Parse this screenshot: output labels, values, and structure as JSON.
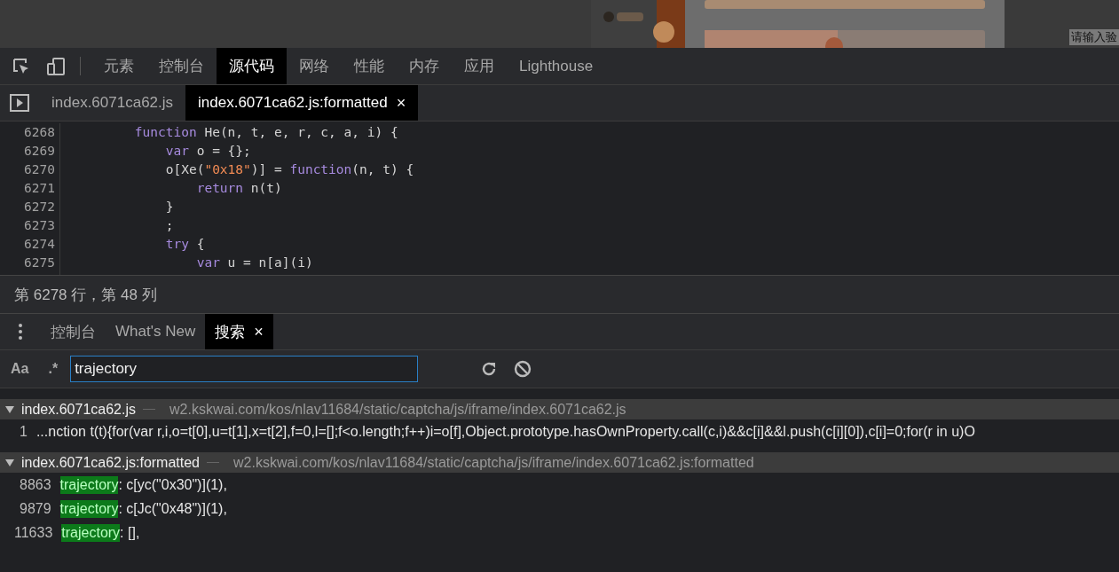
{
  "page_behind": {
    "prompt_text": "请输入验"
  },
  "main_tabs": [
    {
      "label": "元素",
      "selected": false
    },
    {
      "label": "控制台",
      "selected": false
    },
    {
      "label": "源代码",
      "selected": true
    },
    {
      "label": "网络",
      "selected": false
    },
    {
      "label": "性能",
      "selected": false
    },
    {
      "label": "内存",
      "selected": false
    },
    {
      "label": "应用",
      "selected": false
    },
    {
      "label": "Lighthouse",
      "selected": false
    }
  ],
  "file_tabs": [
    {
      "label": "index.6071ca62.js",
      "selected": false,
      "closable": false
    },
    {
      "label": "index.6071ca62.js:formatted",
      "selected": true,
      "closable": true,
      "close": "×"
    }
  ],
  "code": [
    {
      "number": "6268",
      "tokens": [
        {
          "kind": "keyword",
          "text": "        function"
        },
        {
          "kind": "plain",
          "text": " He(n, t, e, r, c, a, i) {"
        }
      ]
    },
    {
      "number": "6269",
      "tokens": [
        {
          "kind": "keyword",
          "text": "            var"
        },
        {
          "kind": "plain",
          "text": " o = {};"
        }
      ]
    },
    {
      "number": "6270",
      "tokens": [
        {
          "kind": "plain",
          "text": "            o[Xe("
        },
        {
          "kind": "string",
          "text": "\"0x18\""
        },
        {
          "kind": "plain",
          "text": ")] = "
        },
        {
          "kind": "keyword",
          "text": "function"
        },
        {
          "kind": "plain",
          "text": "(n, t) {"
        }
      ]
    },
    {
      "number": "6271",
      "tokens": [
        {
          "kind": "keyword",
          "text": "                return"
        },
        {
          "kind": "plain",
          "text": " n(t)"
        }
      ]
    },
    {
      "number": "6272",
      "tokens": [
        {
          "kind": "plain",
          "text": "            }"
        }
      ]
    },
    {
      "number": "6273",
      "tokens": [
        {
          "kind": "plain",
          "text": "            ;"
        }
      ]
    },
    {
      "number": "6274",
      "tokens": [
        {
          "kind": "keyword",
          "text": "            try"
        },
        {
          "kind": "plain",
          "text": " {"
        }
      ]
    },
    {
      "number": "6275",
      "tokens": [
        {
          "kind": "keyword",
          "text": "                var"
        },
        {
          "kind": "plain",
          "text": " u = n[a](i)"
        }
      ]
    }
  ],
  "status_bar": "第 6278 行，第 48 列",
  "drawer_tabs": [
    {
      "label": "控制台",
      "selected": false,
      "closable": false
    },
    {
      "label": "What's New",
      "selected": false,
      "closable": false
    },
    {
      "label": "搜索",
      "selected": true,
      "closable": true,
      "close": "×"
    }
  ],
  "search": {
    "match_case": "Aa",
    "regex": ".*",
    "value": "trajectory"
  },
  "results": [
    {
      "file": "index.6071ca62.js",
      "url": "w2.kskwai.com/kos/nlav11684/static/captcha/js/iframe/index.6071ca62.js",
      "expanded": true,
      "matches": [
        {
          "line": "1",
          "text": "...nction t(t){for(var r,i,o=t[0],u=t[1],x=t[2],f=0,l=[];f<o.length;f++)i=o[f],Object.prototype.hasOwnProperty.call(c,i)&&c[i]&&l.push(c[i][0]),c[i]=0;for(r in u)O"
        }
      ]
    },
    {
      "file": "index.6071ca62.js:formatted",
      "url": "w2.kskwai.com/kos/nlav11684/static/captcha/js/iframe/index.6071ca62.js:formatted",
      "expanded": true,
      "matches": [
        {
          "line": "8863",
          "match": "trajectory",
          "text": ": c[yc(\"0x30\")](1),"
        },
        {
          "line": "9879",
          "match": "trajectory",
          "text": ": c[Jc(\"0x48\")](1),"
        },
        {
          "line": "11633",
          "match": "trajectory",
          "text": ": [],"
        }
      ]
    }
  ]
}
